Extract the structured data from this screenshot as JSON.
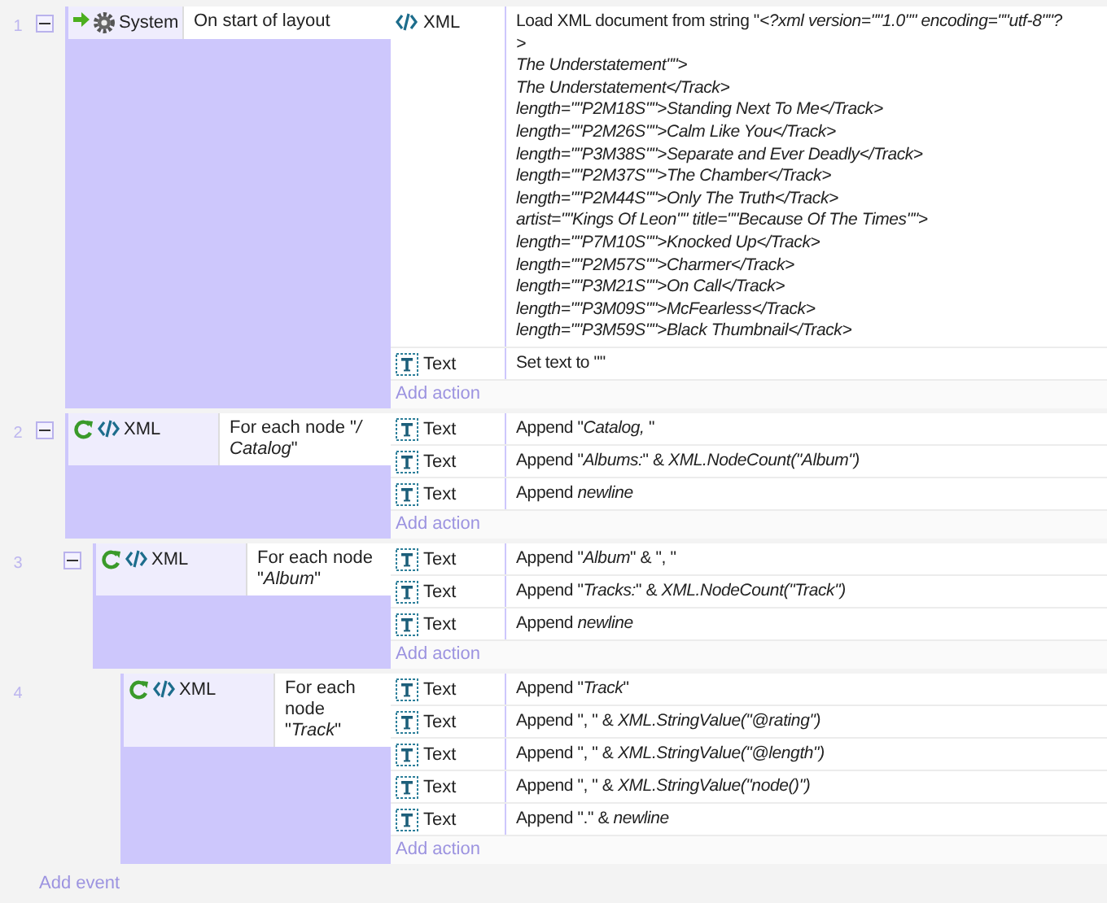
{
  "events": [
    {
      "number": "1",
      "expanded": true,
      "condition": {
        "kind": "system_trigger",
        "object": "System",
        "text": "On start of layout"
      },
      "actions": [
        {
          "object": "XML",
          "kind": "xml",
          "lines": [
            "Load XML document from string \"*<?xml version=\"\"1.0\"\" encoding=\"\"utf-8\"\"?*",
            "*>*",
            "*The Understatement\"\">*",
            "*The Understatement</Track>*",
            "*length=\"\"P2M18S\"\">Standing Next To Me</Track>*",
            "*length=\"\"P2M26S\"\">Calm Like You</Track>*",
            "*length=\"\"P3M38S\"\">Separate and Ever Deadly</Track>*",
            "*length=\"\"P2M37S\"\">The Chamber</Track>*",
            "*length=\"\"P2M44S\"\">Only The Truth</Track>*",
            "*artist=\"\"Kings Of Leon\"\" title=\"\"Because Of The Times\"\">*",
            "*length=\"\"P7M10S\"\">Knocked Up</Track>*",
            "*length=\"\"P2M57S\"\">Charmer</Track>*",
            "*length=\"\"P3M21S\"\">On Call</Track>*",
            "*length=\"\"P3M09S\"\">McFearless</Track>*",
            "*length=\"\"P3M59S\"\">Black Thumbnail</Track>*"
          ]
        },
        {
          "object": "Text",
          "kind": "text",
          "lines": [
            "Set text to \"\""
          ]
        }
      ],
      "add_action": "Add action"
    },
    {
      "number": "2",
      "expanded": true,
      "condition": {
        "kind": "xml_loop",
        "object": "XML",
        "text": "For each node \"*/ Catalog*\""
      },
      "actions": [
        {
          "object": "Text",
          "kind": "text",
          "lines": [
            "Append \"*Catalog,* \""
          ]
        },
        {
          "object": "Text",
          "kind": "text",
          "lines": [
            "Append \"*Albums:*\" & *XML.NodeCount(\"Album\")*"
          ]
        },
        {
          "object": "Text",
          "kind": "text",
          "lines": [
            "Append *newline*"
          ]
        }
      ],
      "add_action": "Add action",
      "children": [
        {
          "number": "3",
          "expanded": true,
          "condition": {
            "kind": "xml_loop",
            "object": "XML",
            "text": "For each node \"*Album*\""
          },
          "actions": [
            {
              "object": "Text",
              "kind": "text",
              "lines": [
                "Append \"*Album*\" & \", \""
              ]
            },
            {
              "object": "Text",
              "kind": "text",
              "lines": [
                "Append \"*Tracks:*\" & *XML.NodeCount(\"Track\")*"
              ]
            },
            {
              "object": "Text",
              "kind": "text",
              "lines": [
                "Append *newline*"
              ]
            }
          ],
          "add_action": "Add action",
          "children": [
            {
              "number": "4",
              "condition": {
                "kind": "xml_loop",
                "object": "XML",
                "text": "For each node \"*Track*\""
              },
              "actions": [
                {
                  "object": "Text",
                  "kind": "text",
                  "lines": [
                    "Append \"*Track*\""
                  ]
                },
                {
                  "object": "Text",
                  "kind": "text",
                  "lines": [
                    "Append \", \" & *XML.StringValue(\"@rating\")*"
                  ]
                },
                {
                  "object": "Text",
                  "kind": "text",
                  "lines": [
                    "Append \", \" & *XML.StringValue(\"@length\")*"
                  ]
                },
                {
                  "object": "Text",
                  "kind": "text",
                  "lines": [
                    "Append \", \" & *XML.StringValue(\"node()\")*"
                  ]
                },
                {
                  "object": "Text",
                  "kind": "text",
                  "lines": [
                    "Append \".\" & *newline*"
                  ]
                }
              ],
              "add_action": "Add action"
            }
          ]
        }
      ]
    }
  ],
  "add_event": "Add event"
}
